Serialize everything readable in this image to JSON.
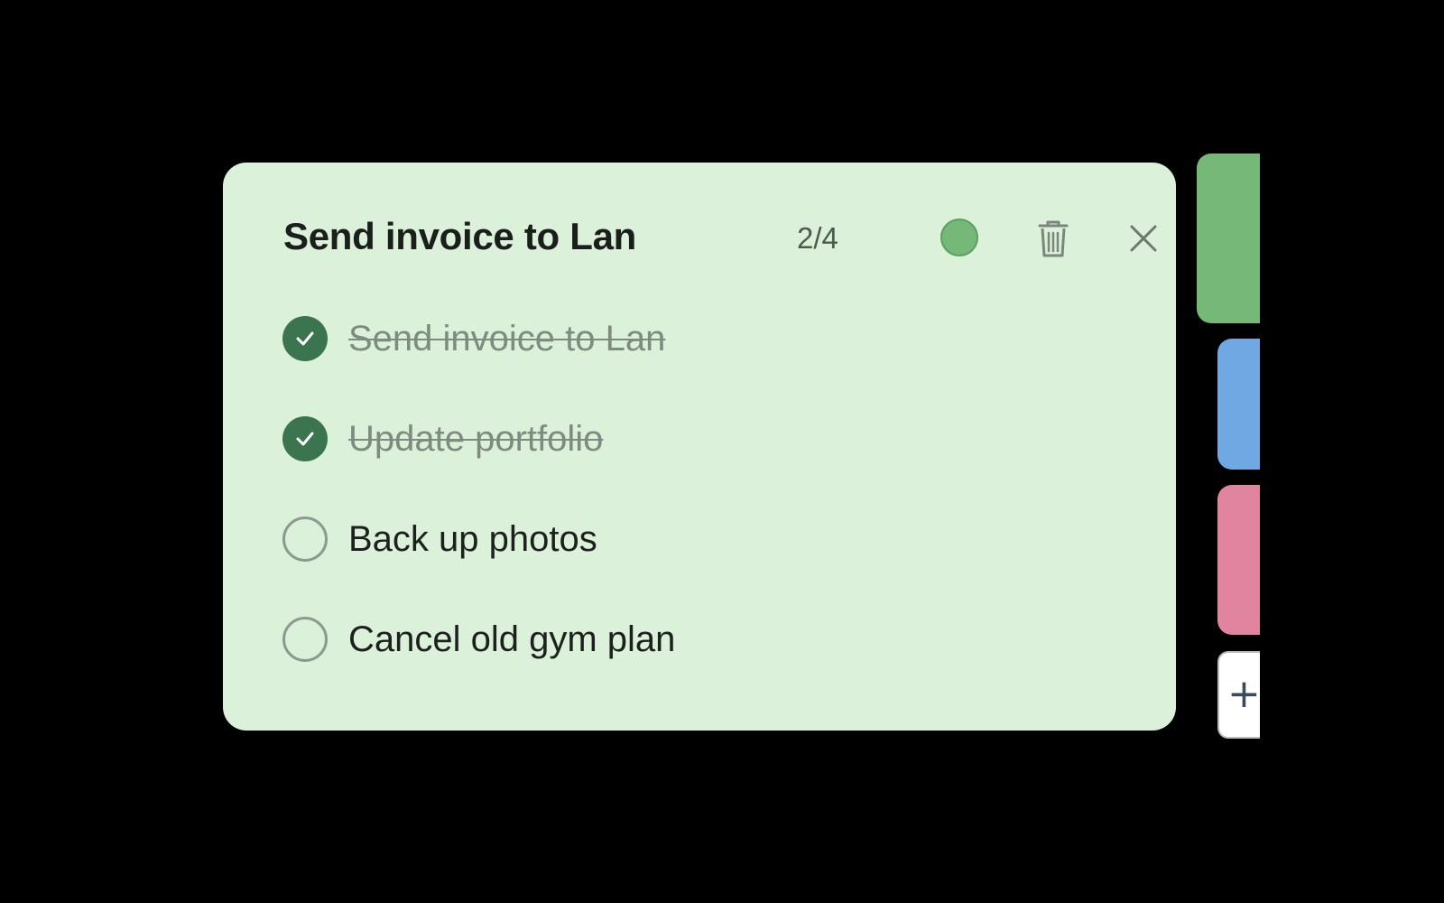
{
  "note": {
    "title": "Send invoice to Lan",
    "progress_text": "2/4",
    "color": "#75b877",
    "background": "#dcf1da",
    "items": [
      {
        "label": "Send invoice to Lan",
        "done": true
      },
      {
        "label": "Update portfolio",
        "done": true
      },
      {
        "label": "Back up photos",
        "done": false
      },
      {
        "label": "Cancel old gym plan",
        "done": false
      }
    ]
  },
  "icons": {
    "color_picker": "color-dot-icon",
    "delete": "trash-icon",
    "close": "close-icon",
    "check": "check-icon",
    "add": "plus-icon"
  },
  "side_tabs": [
    {
      "name": "green-note",
      "color": "#75b877",
      "active": true
    },
    {
      "name": "blue-note",
      "color": "#6fa8e2",
      "active": false
    },
    {
      "name": "pink-note",
      "color": "#e0849f",
      "active": false
    }
  ],
  "add_tab": {
    "label": "+"
  }
}
